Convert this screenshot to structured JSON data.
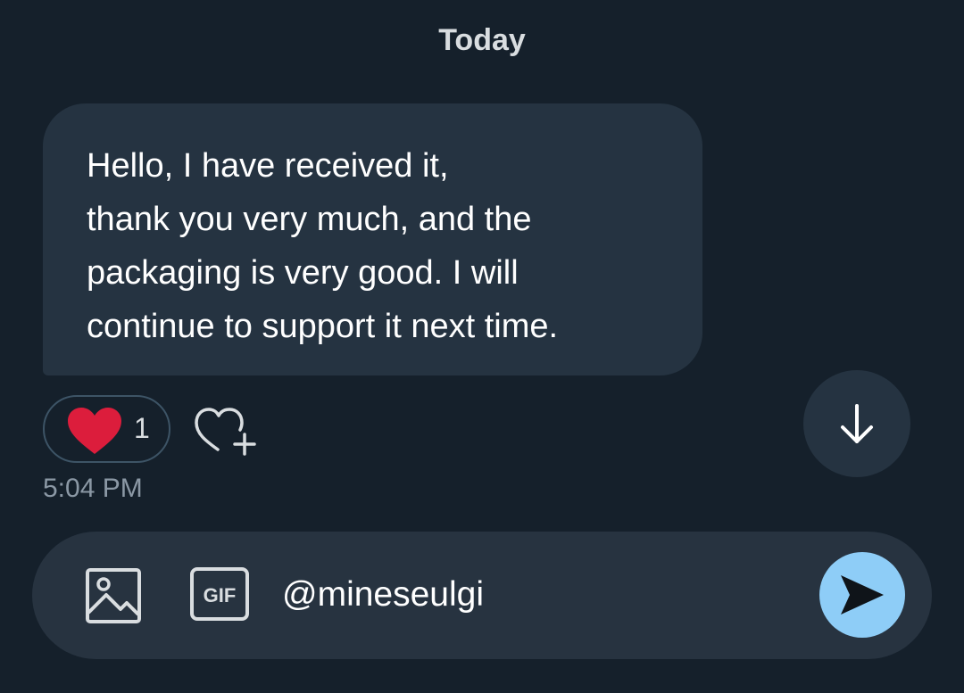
{
  "conversation": {
    "date_divider": "Today",
    "message": {
      "lines": [
        "Hello, I have received it,",
        "thank you very much, and the",
        "packaging is very good. I will",
        "continue to support it next time."
      ],
      "reaction_count": "1",
      "timestamp": "5:04 PM"
    }
  },
  "composer": {
    "input_value": "@mineseulgi",
    "media_icon": "image-icon",
    "gif_label": "GIF",
    "send_icon": "send-icon"
  },
  "colors": {
    "background": "#15202b",
    "bubble": "#253341",
    "heart": "#f91880",
    "send_button": "#8ecdf7",
    "muted_text": "#8b98a5"
  }
}
